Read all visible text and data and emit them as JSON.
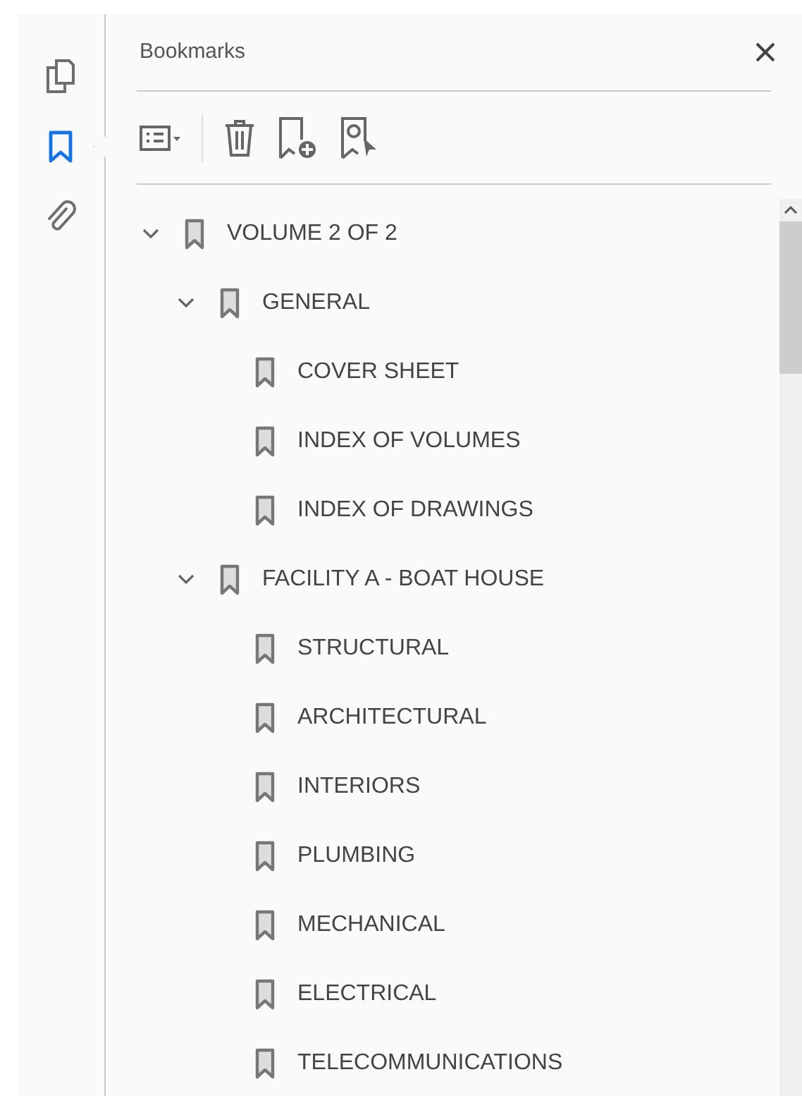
{
  "rail": [
    {
      "kind": "pages",
      "selected": false
    },
    {
      "kind": "bookmarks",
      "selected": true
    },
    {
      "kind": "attachments",
      "selected": false
    }
  ],
  "panel": {
    "title": "Bookmarks"
  },
  "tree": [
    {
      "label": "VOLUME 2 OF 2",
      "expanded": true,
      "children": [
        {
          "label": "GENERAL",
          "expanded": true,
          "children": [
            {
              "label": "COVER SHEET"
            },
            {
              "label": "INDEX OF VOLUMES"
            },
            {
              "label": "INDEX OF DRAWINGS"
            }
          ]
        },
        {
          "label": "FACILITY A - BOAT HOUSE",
          "expanded": true,
          "children": [
            {
              "label": "STRUCTURAL"
            },
            {
              "label": "ARCHITECTURAL"
            },
            {
              "label": "INTERIORS"
            },
            {
              "label": "PLUMBING"
            },
            {
              "label": "MECHANICAL"
            },
            {
              "label": "ELECTRICAL"
            },
            {
              "label": "TELECOMMUNICATIONS"
            }
          ]
        }
      ]
    }
  ]
}
